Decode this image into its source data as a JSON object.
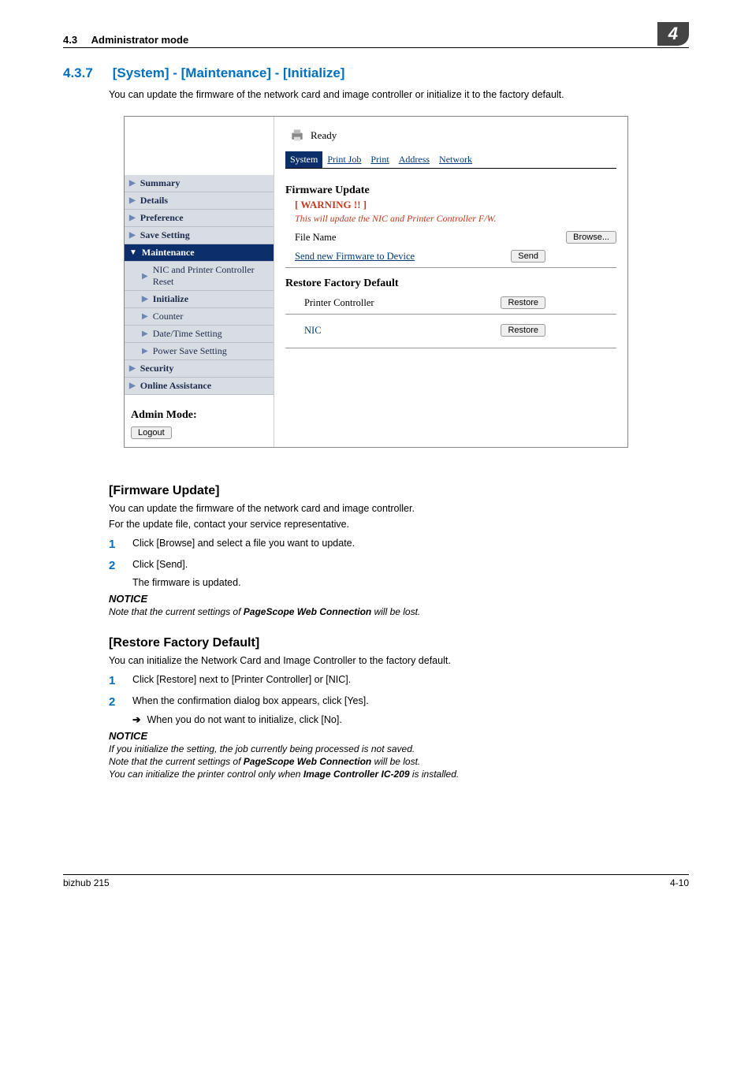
{
  "header": {
    "section_ref": "4.3",
    "section_label": "Administrator mode",
    "chapter_badge": "4"
  },
  "title": {
    "num": "4.3.7",
    "text": "[System] - [Maintenance] - [Initialize]"
  },
  "intro": "You can update the firmware of the network card and image controller or initialize it to the factory default.",
  "shot": {
    "status": "Ready",
    "tabs": {
      "system": "System",
      "printjob": "Print Job",
      "print": "Print",
      "address": "Address",
      "network": "Network"
    },
    "sidebar": {
      "summary": "Summary",
      "details": "Details",
      "preference": "Preference",
      "save_setting": "Save Setting",
      "maintenance": "Maintenance",
      "nic_reset": "NIC and Printer Controller Reset",
      "initialize": "Initialize",
      "counter": "Counter",
      "datetime": "Date/Time Setting",
      "powersave": "Power Save Setting",
      "security": "Security",
      "online_assist": "Online Assistance"
    },
    "admin": {
      "label": "Admin Mode:",
      "logout": "Logout"
    },
    "panel": {
      "fw_heading": "Firmware Update",
      "warning": "[ WARNING !! ]",
      "desc": "This will update the NIC and Printer Controller F/W.",
      "filename": "File Name",
      "browse": "Browse...",
      "send_label": "Send new Firmware to Device",
      "send_btn": "Send",
      "rf_heading": "Restore Factory Default",
      "printer_controller": "Printer Controller",
      "restore1": "Restore",
      "nic": "NIC",
      "restore2": "Restore"
    }
  },
  "fw_section": {
    "heading": "[Firmware Update]",
    "p1": "You can update the firmware of the network card and image controller.",
    "p2": "For the update file, contact your service representative.",
    "step1": "Click [Browse] and select a file you want to update.",
    "step2": "Click [Send].",
    "step2_result": "The firmware is updated.",
    "notice": "NOTICE",
    "notice_body_pre": "Note that the current settings of ",
    "notice_body_bold": "PageScope Web Connection",
    "notice_body_post": " will be lost."
  },
  "rf_section": {
    "heading": "[Restore Factory Default]",
    "p1": "You can initialize the Network Card and Image Controller to the factory default.",
    "step1": "Click [Restore] next to [Printer Controller] or [NIC].",
    "step2": "When the confirmation dialog box appears, click [Yes].",
    "sub": "When you do not want to initialize, click [No].",
    "notice": "NOTICE",
    "n1": "If you initialize the setting, the job currently being processed is not saved.",
    "n2_pre": "Note that the current settings of ",
    "n2_bold": "PageScope Web Connection",
    "n2_post": " will be lost.",
    "n3_pre": "You can initialize the printer control only when ",
    "n3_bold": "Image Controller IC-209",
    "n3_post": " is installed."
  },
  "footer": {
    "left": "bizhub 215",
    "right": "4-10"
  }
}
